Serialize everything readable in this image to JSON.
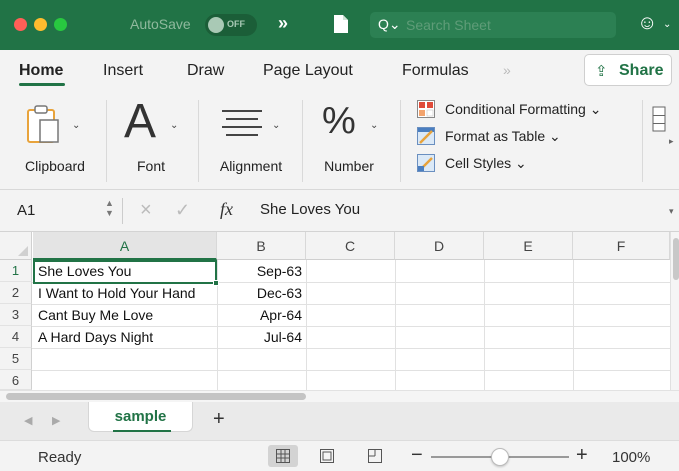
{
  "titlebar": {
    "autosave_label": "AutoSave",
    "autosave_state": "OFF",
    "search_placeholder": "Search Sheet"
  },
  "ribbon_tabs": {
    "items": [
      "Home",
      "Insert",
      "Draw",
      "Page Layout",
      "Formulas"
    ],
    "active": "Home",
    "share_label": "Share"
  },
  "ribbon": {
    "clipboard": "Clipboard",
    "font": "Font",
    "alignment": "Alignment",
    "number": "Number",
    "number_glyph": "%",
    "font_glyph": "A",
    "conditional_formatting": "Conditional Formatting",
    "format_as_table": "Format as Table",
    "cell_styles": "Cell Styles"
  },
  "formula_bar": {
    "name_box": "A1",
    "fx": "fx",
    "content": "She Loves You"
  },
  "grid": {
    "columns": [
      "A",
      "B",
      "C",
      "D",
      "E",
      "F"
    ],
    "row_numbers": [
      "1",
      "2",
      "3",
      "4",
      "5",
      "6"
    ],
    "rows": [
      {
        "a": "She Loves You",
        "b": "Sep-63"
      },
      {
        "a": "I Want to Hold Your Hand",
        "b": "Dec-63"
      },
      {
        "a": "Cant Buy Me Love",
        "b": "Apr-64"
      },
      {
        "a": "A Hard Days Night",
        "b": "Jul-64"
      }
    ],
    "selected_cell": "A1"
  },
  "sheets": {
    "tabs": [
      "sample"
    ],
    "add_label": "+"
  },
  "status": {
    "text": "Ready",
    "zoom": "100%",
    "zoom_fraction": 0.5
  },
  "colors": {
    "accent": "#217346",
    "titlebar": "#217346"
  }
}
